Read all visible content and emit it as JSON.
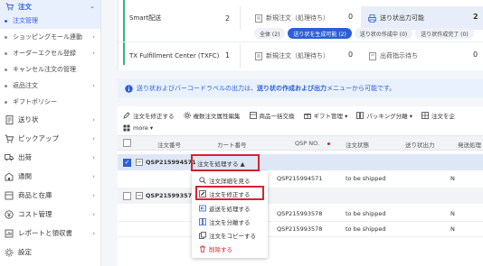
{
  "sidebar": {
    "header": {
      "label": "注文"
    },
    "subitems": [
      {
        "label": "注文管理",
        "active": true
      },
      {
        "label": "ショッピングモール連動",
        "arrow": true
      },
      {
        "label": "オーダーエクセル登録",
        "arrow": true
      },
      {
        "label": "キャンセル注文の管理"
      },
      {
        "label": "返品注文",
        "arrow": true
      },
      {
        "label": "ギフトポリシー"
      }
    ],
    "items": [
      {
        "label": "送り状",
        "icon": "document-icon"
      },
      {
        "label": "ピックアップ",
        "icon": "cart-icon"
      },
      {
        "label": "出荷",
        "icon": "truck-icon"
      },
      {
        "label": "通関",
        "icon": "building-icon"
      },
      {
        "label": "商品と在庫",
        "icon": "box-icon"
      },
      {
        "label": "コスト管理",
        "icon": "yen-icon"
      },
      {
        "label": "レポートと領収書",
        "icon": "chart-icon"
      },
      {
        "label": "設定",
        "icon": "gear-icon"
      }
    ]
  },
  "status_panel": {
    "stores": [
      {
        "name": "Smart配送",
        "count": "2"
      },
      {
        "name": "TX Fulfillment Center (TXFC)",
        "count": "1"
      }
    ],
    "row1": [
      {
        "label": "新規注文（処理待ち）",
        "count": "0"
      },
      {
        "label": "送り状出力可能",
        "count": "2"
      }
    ],
    "row3": [
      {
        "label": "新規注文（処理待ち）",
        "count": "0"
      },
      {
        "label": "出荷指示待ち",
        "count": "0"
      }
    ],
    "chips": [
      "全体 (2)",
      "送り状を生成可能 (2)",
      "送り状の作成中 (0)",
      "送り状作成完了 (0)"
    ]
  },
  "banner": {
    "text_a": "送り状およびバーコードラベルの出力は、",
    "text_link": "送り状の作成および出力",
    "text_b": "メニューから可能です。"
  },
  "toolbar": {
    "row1": [
      "注文を修正する",
      "複数注文属性編集",
      "商品一括交換",
      "ギフト管理 ▾",
      "パッキング分離 ▾",
      "注文を企"
    ],
    "more": "more ▾"
  },
  "table": {
    "headers": [
      "注文番号",
      "カート番号",
      "QSP NO.",
      "注文状態",
      "送り状出力",
      "発送処理"
    ],
    "rows": [
      {
        "order": "QSP215994571",
        "qsp": "QSP215994571",
        "status": "to be shipped",
        "n": "N",
        "checked": true,
        "action": "注文を処理する ▲"
      },
      {
        "order": "QSP215993578",
        "qsp": "",
        "status": "",
        "n": "",
        "checked": false
      },
      {
        "order": "",
        "qsp": "QSP215993578",
        "status": "to be shipped",
        "n": "N"
      },
      {
        "order": "",
        "qsp": "QSP215993578",
        "status": "to be shipped",
        "n": "N"
      }
    ]
  },
  "dropdown": {
    "items": [
      {
        "label": "注文詳細を見る",
        "icon": "search-icon"
      },
      {
        "label": "注文を修正する",
        "icon": "edit-icon",
        "highlight": true
      },
      {
        "label": "返送を処理する",
        "icon": "return-icon"
      },
      {
        "label": "注文を分離する",
        "icon": "split-icon"
      },
      {
        "label": "注文をコピーする",
        "icon": "copy-icon"
      },
      {
        "label": "削除する",
        "icon": "trash-icon",
        "danger": true
      }
    ]
  },
  "colors": {
    "accent": "#2b5fd9",
    "highlight_box": "#d9232d",
    "status_bar": "#2fb87b"
  }
}
